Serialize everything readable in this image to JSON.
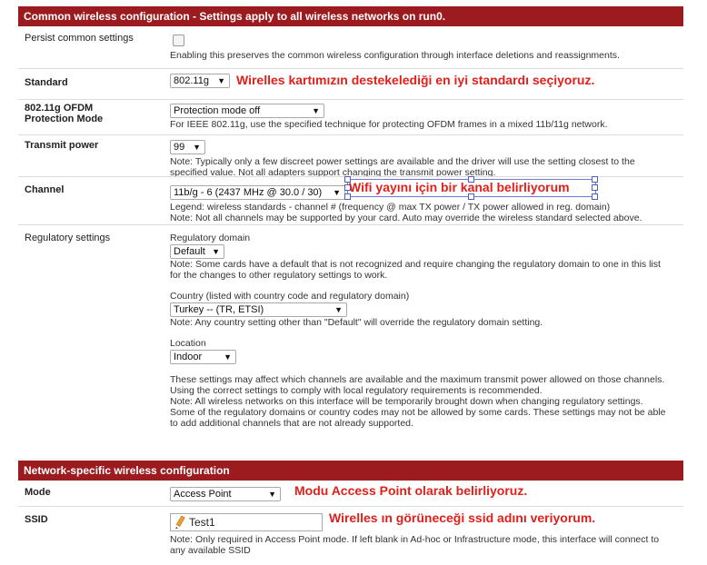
{
  "common": {
    "title": "Common wireless configuration - Settings apply to all wireless networks on run0.",
    "persist": {
      "label": "Persist common settings",
      "note": "Enabling this preserves the common wireless configuration through interface deletions and reassignments."
    },
    "standard": {
      "label": "Standard",
      "value": "802.11g",
      "annotation": "Wirelles kartımızın destekelediği en iyi standardı seçiyoruz."
    },
    "ofdm": {
      "label1": "802.11g OFDM",
      "label2": "Protection Mode",
      "value": "Protection mode off",
      "note": "For IEEE 802.11g, use the specified technique for protecting OFDM frames in a mixed 11b/11g network."
    },
    "txpower": {
      "label": "Transmit power",
      "value": "99",
      "note1": "Note: Typically only a few discreet power settings are available and the driver will use the setting closest to the",
      "note2": "specified value. Not all adapters support changing the transmit power setting."
    },
    "channel": {
      "label": "Channel",
      "value": "11b/g - 6 (2437 MHz @ 30.0 / 30)",
      "annotation": "Wifi yayını için bir kanal belirliyorum",
      "legend": "Legend: wireless standards - channel # (frequency @ max TX power / TX power allowed in reg. domain)",
      "note": "Note: Not all channels may be supported by your card. Auto may override the wireless standard selected above."
    },
    "regulatory": {
      "label": "Regulatory settings",
      "domain_label": "Regulatory domain",
      "domain_value": "Default",
      "domain_note1": "Note: Some cards have a default that is not recognized and require changing the regulatory domain to one in this list",
      "domain_note2": "for the changes to other regulatory settings to work.",
      "country_label": "Country (listed with country code and regulatory domain)",
      "country_value": "Turkey -- (TR, ETSI)",
      "country_note": "Note: Any country setting other than \"Default\" will override the regulatory domain setting.",
      "location_label": "Location",
      "location_value": "Indoor",
      "final_note": [
        "These settings may affect which channels are available and the maximum transmit power allowed on those channels.",
        "Using the correct settings to comply with local regulatory requirements is recommended.",
        "Note: All wireless networks on this interface will be temporarily brought down when changing regulatory settings.",
        "Some of the regulatory domains or country codes may not be allowed by some cards. These settings may not be able",
        "to add additional channels that are not already supported."
      ]
    }
  },
  "network": {
    "title": "Network-specific wireless configuration",
    "mode": {
      "label": "Mode",
      "value": "Access Point",
      "annotation": "Modu Access Point olarak belirliyoruz."
    },
    "ssid": {
      "label": "SSID",
      "value": "Test1",
      "annotation": "Wirelles ın görüneceği ssid adını veriyorum.",
      "note1": "Note: Only required in Access Point mode. If left blank in Ad-hoc or Infrastructure mode, this interface will connect to",
      "note2": "any available SSID"
    }
  },
  "colors": {
    "header_bg": "#9b1b1f",
    "annotation": "#e0201b"
  }
}
